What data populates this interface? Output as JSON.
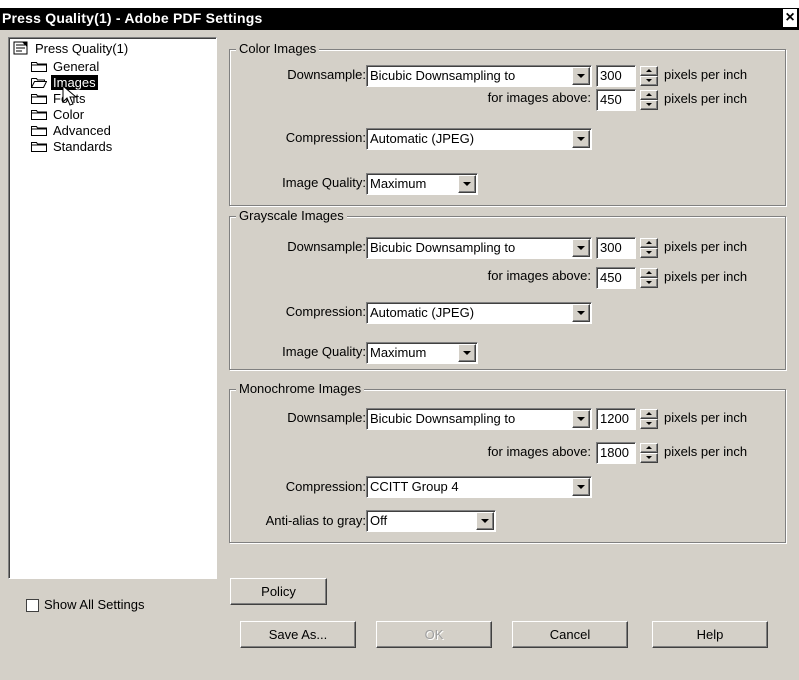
{
  "window": {
    "title": "Press Quality(1) - Adobe PDF Settings",
    "close_glyph": "×"
  },
  "tree": {
    "root": "Press Quality(1)",
    "items": [
      {
        "label": "General"
      },
      {
        "label": "Images",
        "selected": true
      },
      {
        "label": "Fonts"
      },
      {
        "label": "Color"
      },
      {
        "label": "Advanced"
      },
      {
        "label": "Standards"
      }
    ]
  },
  "show_all": {
    "label": "Show All Settings",
    "checked": false
  },
  "color_images": {
    "legend": "Color Images",
    "downsample_label": "Downsample:",
    "downsample_value": "Bicubic Downsampling to",
    "resolution": "300",
    "above_label": "for images above:",
    "above_value": "450",
    "unit": "pixels per inch",
    "compression_label": "Compression:",
    "compression_value": "Automatic (JPEG)",
    "quality_label": "Image Quality:",
    "quality_value": "Maximum"
  },
  "grayscale_images": {
    "legend": "Grayscale Images",
    "downsample_label": "Downsample:",
    "downsample_value": "Bicubic Downsampling to",
    "resolution": "300",
    "above_label": "for images above:",
    "above_value": "450",
    "unit": "pixels per inch",
    "compression_label": "Compression:",
    "compression_value": "Automatic (JPEG)",
    "quality_label": "Image Quality:",
    "quality_value": "Maximum"
  },
  "monochrome_images": {
    "legend": "Monochrome Images",
    "downsample_label": "Downsample:",
    "downsample_value": "Bicubic Downsampling to",
    "resolution": "1200",
    "above_label": "for images above:",
    "above_value": "1800",
    "unit": "pixels per inch",
    "compression_label": "Compression:",
    "compression_value": "CCITT Group 4",
    "antialias_label": "Anti-alias to gray:",
    "antialias_value": "Off"
  },
  "buttons": {
    "policy": "Policy",
    "save_as": "Save As...",
    "ok": "OK",
    "cancel": "Cancel",
    "help": "Help"
  },
  "colors": {
    "dialog_bg": "#d4d0c8",
    "titlebar_bg": "#000000",
    "selection_bg": "#000000"
  }
}
